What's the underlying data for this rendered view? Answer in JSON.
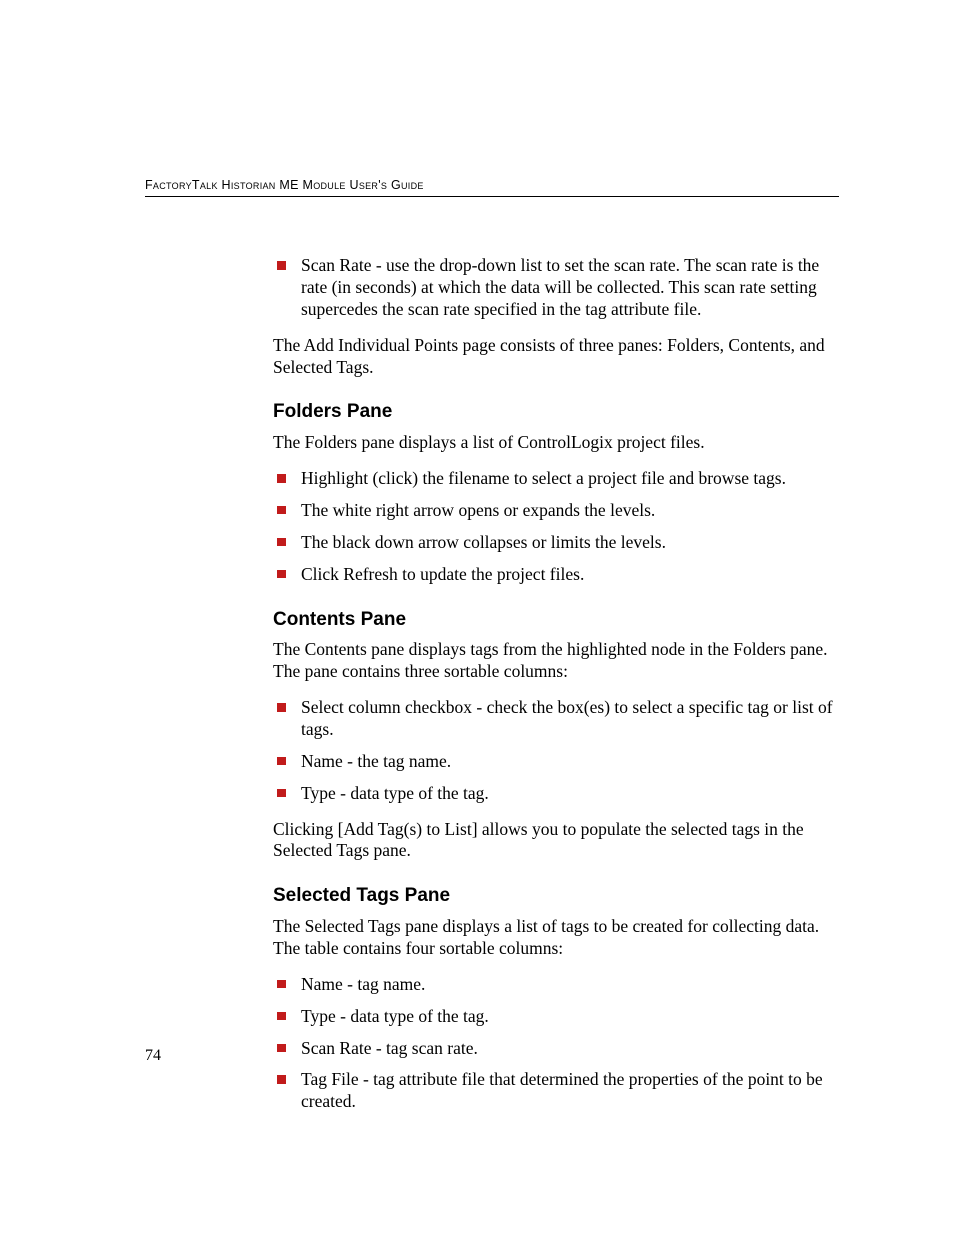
{
  "header": {
    "running_head": "FactoryTalk Historian ME Module User's Guide"
  },
  "intro": {
    "scan_rate_bullet": "Scan Rate - use the drop-down list to set the scan rate. The scan rate is the rate (in seconds) at which the data will be collected. This scan rate setting supercedes the scan rate specified in the tag attribute file.",
    "panes_paragraph": "The Add Individual Points page consists of three panes: Folders, Contents, and Selected Tags."
  },
  "folders": {
    "heading": "Folders Pane",
    "intro": "The Folders pane displays a list of ControlLogix project files.",
    "items": [
      "Highlight (click) the filename to select a project file and browse tags.",
      "The white right arrow opens or expands the levels.",
      "The black down arrow collapses or limits the levels.",
      "Click Refresh to update the project files."
    ]
  },
  "contents": {
    "heading": "Contents Pane",
    "intro": "The Contents pane displays tags from the highlighted node in the Folders pane. The pane contains three sortable columns:",
    "items": [
      "Select column checkbox - check the box(es) to select a specific tag or list of tags.",
      "Name - the tag name.",
      "Type - data type of the tag."
    ],
    "closing": "Clicking [Add Tag(s) to List] allows you to populate the selected tags in the Selected Tags pane."
  },
  "selected_tags": {
    "heading": "Selected Tags Pane",
    "intro": "The Selected Tags pane displays a list of tags to be created for collecting data. The table contains four sortable columns:",
    "items": [
      "Name - tag name.",
      "Type - data type of the tag.",
      "Scan Rate - tag scan rate.",
      "Tag File - tag attribute file that determined the properties of the point to be created."
    ]
  },
  "footer": {
    "page_number": "74"
  }
}
